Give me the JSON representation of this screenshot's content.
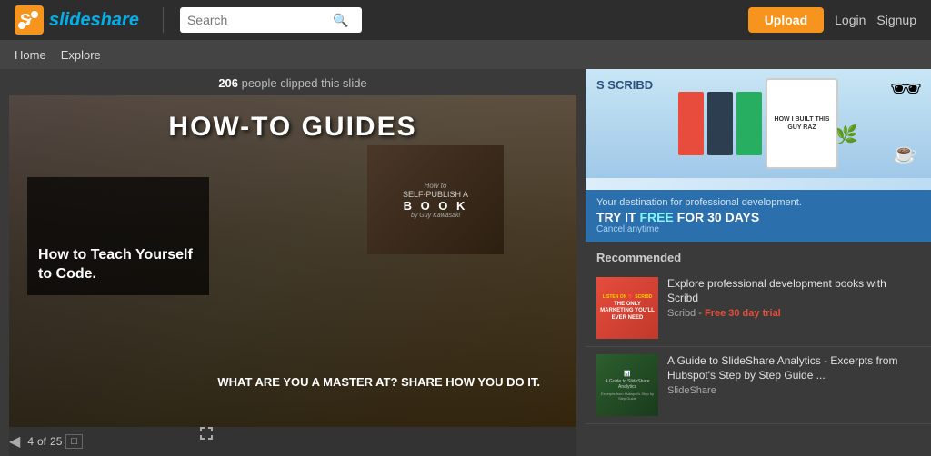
{
  "header": {
    "logo_text": "slideshare",
    "search_placeholder": "Search",
    "upload_label": "Upload",
    "login_label": "Login",
    "signup_label": "Signup"
  },
  "subnav": {
    "home_label": "Home",
    "explore_label": "Explore"
  },
  "slide": {
    "clipped_count": "206",
    "clipped_text": " people clipped this slide",
    "title": "HOW-TO GUIDES",
    "card1_how_to": "How to",
    "card1_action": "SELF-PUBLISH A",
    "card1_book": "B O O K",
    "card1_author": "by Guy Kawasaki",
    "card2_title": "How to Teach Yourself to Code.",
    "bottom_text": "WHAT ARE YOU A MASTER AT? SHARE HOW YOU DO IT.",
    "page_current": "4",
    "page_total": "25",
    "page_of": "of"
  },
  "ad": {
    "logo": "S SCRIBD",
    "logo2": "S SCRIBD",
    "desc": "Your destination for professional development.",
    "cta_prefix": "TRY IT ",
    "cta_free": "FREE",
    "cta_suffix": " FOR 30 DAYS",
    "cancel": "Cancel anytime",
    "tablet_text": "HOW I BUILT THIS GUY RAZ"
  },
  "recommended": {
    "section_label": "Recommended",
    "items": [
      {
        "thumb_label": "LISTEN ON SCRIBD THE ONLY MARKETING YOU'LL EVER NEED",
        "title": "Explore professional development books with Scribd",
        "source": "Scribd - ",
        "source_highlight": "Free 30 day trial"
      },
      {
        "thumb_label": "A Guide to SlideShare Analytics",
        "title": "A Guide to SlideShare Analytics - Excerpts from Hubspot's Step by Step Guide ...",
        "source": "SlideShare",
        "source_highlight": ""
      }
    ]
  }
}
